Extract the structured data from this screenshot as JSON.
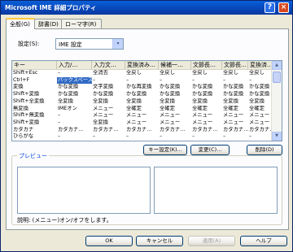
{
  "window": {
    "title": "Microsoft IME 詳細プロパティ",
    "help_glyph": "?",
    "close_glyph": "×"
  },
  "tabs": [
    {
      "label": "全般(G)"
    },
    {
      "label": "辞書(D)"
    },
    {
      "label": "ローマ字(R)"
    }
  ],
  "keyset": {
    "label": "設定(S):",
    "value": "IME 設定",
    "arrow": "▾"
  },
  "keys_table": {
    "columns": [
      "キー",
      "入力/…",
      "入力文…",
      "変換済み…",
      "候補一…",
      "文節長…",
      "文節長…",
      "変換済…"
    ],
    "rows": [
      [
        "Shift+Esc",
        "–",
        "全消去",
        "全戻し",
        "全戻し",
        "全戻し",
        "全戻し",
        "全戻し"
      ],
      [
        "Ctrl+F",
        "バックスペース",
        "–",
        "–",
        "–",
        "–",
        "–",
        "–"
      ],
      [
        "変換",
        "かな変換",
        "文字変換",
        "かな再変換",
        "かな変換",
        "かな変換",
        "かな変換",
        "かな変換"
      ],
      [
        "Shift+変換",
        "かな変換",
        "かな変換",
        "かな変換",
        "かな変換",
        "かな変換",
        "かな変換",
        "かな変換"
      ],
      [
        "Shift+全変換",
        "全変換",
        "全変換",
        "全変換",
        "全変換",
        "全変換",
        "全変換",
        "全変換"
      ],
      [
        "無変換",
        "IMEオン",
        "メニュー",
        "全確定",
        "全確定",
        "全確定",
        "全確定",
        "全確定"
      ],
      [
        "Shift+無変換",
        "–",
        "メニュー",
        "メニュー",
        "メニュー",
        "メニュー",
        "メニュー",
        "メニュー"
      ],
      [
        "Shift+変換",
        "–",
        "全変換",
        "メニュー",
        "メニュー",
        "メニュー",
        "メニュー",
        "メニュー"
      ],
      [
        "カタカナ",
        "カタカナ…",
        "カタカナ…",
        "カタカナ…",
        "カタカナ…",
        "カタカナ…",
        "カタカナ…",
        "カタカナ…"
      ],
      [
        "ひらがな",
        "–",
        "–",
        "–",
        "–",
        "–",
        "–",
        "–"
      ]
    ],
    "selected_row": 1,
    "selected_col": 1
  },
  "buttons": {
    "keyset_add": "キー設定(K)...",
    "change": "変更(C)...",
    "delete": "削除(D)"
  },
  "preview": {
    "label": "プレビュー",
    "description": "説明: (メニュー)オン/オフをします。"
  },
  "footer": {
    "ok": "OK",
    "cancel": "キャンセル",
    "apply": "適用(A)",
    "help": "ヘルプ"
  },
  "colors": {
    "titlebar": "#0845b8",
    "selection": "#316ac5",
    "panel": "#fcfcfe",
    "dialog": "#ece9d8",
    "tab_accent": "#ffc83c"
  }
}
